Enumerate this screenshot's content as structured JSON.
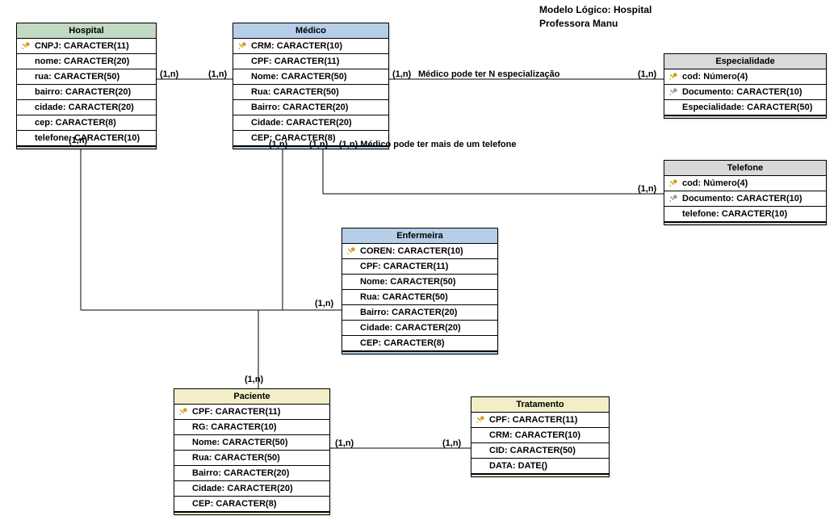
{
  "title": {
    "line1": "Modelo Lógico: Hospital",
    "line2": "Professora Manu"
  },
  "entities": {
    "hospital": {
      "name": "Hospital",
      "attrs": [
        {
          "key": "pk",
          "text": "CNPJ: CARACTER(11)"
        },
        {
          "key": "",
          "text": "nome: CARACTER(20)"
        },
        {
          "key": "",
          "text": "rua: CARACTER(50)"
        },
        {
          "key": "",
          "text": "bairro: CARACTER(20)"
        },
        {
          "key": "",
          "text": "cidade: CARACTER(20)"
        },
        {
          "key": "",
          "text": "cep: CARACTER(8)"
        },
        {
          "key": "",
          "text": "telefone: CARACTER(10)"
        }
      ]
    },
    "medico": {
      "name": "Médico",
      "attrs": [
        {
          "key": "pk",
          "text": "CRM: CARACTER(10)"
        },
        {
          "key": "",
          "text": "CPF: CARACTER(11)"
        },
        {
          "key": "",
          "text": "Nome: CARACTER(50)"
        },
        {
          "key": "",
          "text": "Rua: CARACTER(50)"
        },
        {
          "key": "",
          "text": "Bairro: CARACTER(20)"
        },
        {
          "key": "",
          "text": "Cidade: CARACTER(20)"
        },
        {
          "key": "",
          "text": "CEP: CARACTER(8)"
        }
      ]
    },
    "especialidade": {
      "name": "Especialidade",
      "attrs": [
        {
          "key": "pk",
          "text": "cod: Número(4)"
        },
        {
          "key": "fk",
          "text": "Documento: CARACTER(10)"
        },
        {
          "key": "",
          "text": "Especialidade: CARACTER(50)"
        }
      ]
    },
    "telefone": {
      "name": "Telefone",
      "attrs": [
        {
          "key": "pk",
          "text": "cod: Número(4)"
        },
        {
          "key": "fk",
          "text": "Documento: CARACTER(10)"
        },
        {
          "key": "",
          "text": "telefone: CARACTER(10)"
        }
      ]
    },
    "enfermeira": {
      "name": "Enfermeira",
      "attrs": [
        {
          "key": "pk",
          "text": "COREN: CARACTER(10)"
        },
        {
          "key": "",
          "text": "CPF: CARACTER(11)"
        },
        {
          "key": "",
          "text": "Nome: CARACTER(50)"
        },
        {
          "key": "",
          "text": "Rua: CARACTER(50)"
        },
        {
          "key": "",
          "text": "Bairro: CARACTER(20)"
        },
        {
          "key": "",
          "text": "Cidade: CARACTER(20)"
        },
        {
          "key": "",
          "text": "CEP: CARACTER(8)"
        }
      ]
    },
    "paciente": {
      "name": "Paciente",
      "attrs": [
        {
          "key": "pk",
          "text": "CPF: CARACTER(11)"
        },
        {
          "key": "",
          "text": "RG: CARACTER(10)"
        },
        {
          "key": "",
          "text": "Nome: CARACTER(50)"
        },
        {
          "key": "",
          "text": "Rua: CARACTER(50)"
        },
        {
          "key": "",
          "text": "Bairro: CARACTER(20)"
        },
        {
          "key": "",
          "text": "Cidade: CARACTER(20)"
        },
        {
          "key": "",
          "text": "CEP: CARACTER(8)"
        }
      ]
    },
    "tratamento": {
      "name": "Tratamento",
      "attrs": [
        {
          "key": "pk",
          "text": "CPF: CARACTER(11)"
        },
        {
          "key": "",
          "text": "CRM: CARACTER(10)"
        },
        {
          "key": "",
          "text": "CID: CARACTER(50)"
        },
        {
          "key": "",
          "text": "DATA: DATE()"
        }
      ]
    }
  },
  "cardinalities": {
    "hosp_med_left": "(1,n)",
    "hosp_med_right": "(1,n)",
    "med_esp_left": "(1,n)",
    "med_esp_right": "(1,n)",
    "med_esp_label": "Médico pode ter N especialização",
    "med_tel_left_a": "(1,n)",
    "med_tel_left_b": "(1,n)",
    "med_tel_right": "(1,n)",
    "med_tel_label": "Médico pode ter mais de um telefone",
    "hosp_enf_top": "(1,n)",
    "hosp_enf_bottom": "(1,n)",
    "med_pac_top": "(1,n)",
    "pac_trat_left": "(1,n)",
    "pac_trat_right": "(1,n)"
  }
}
